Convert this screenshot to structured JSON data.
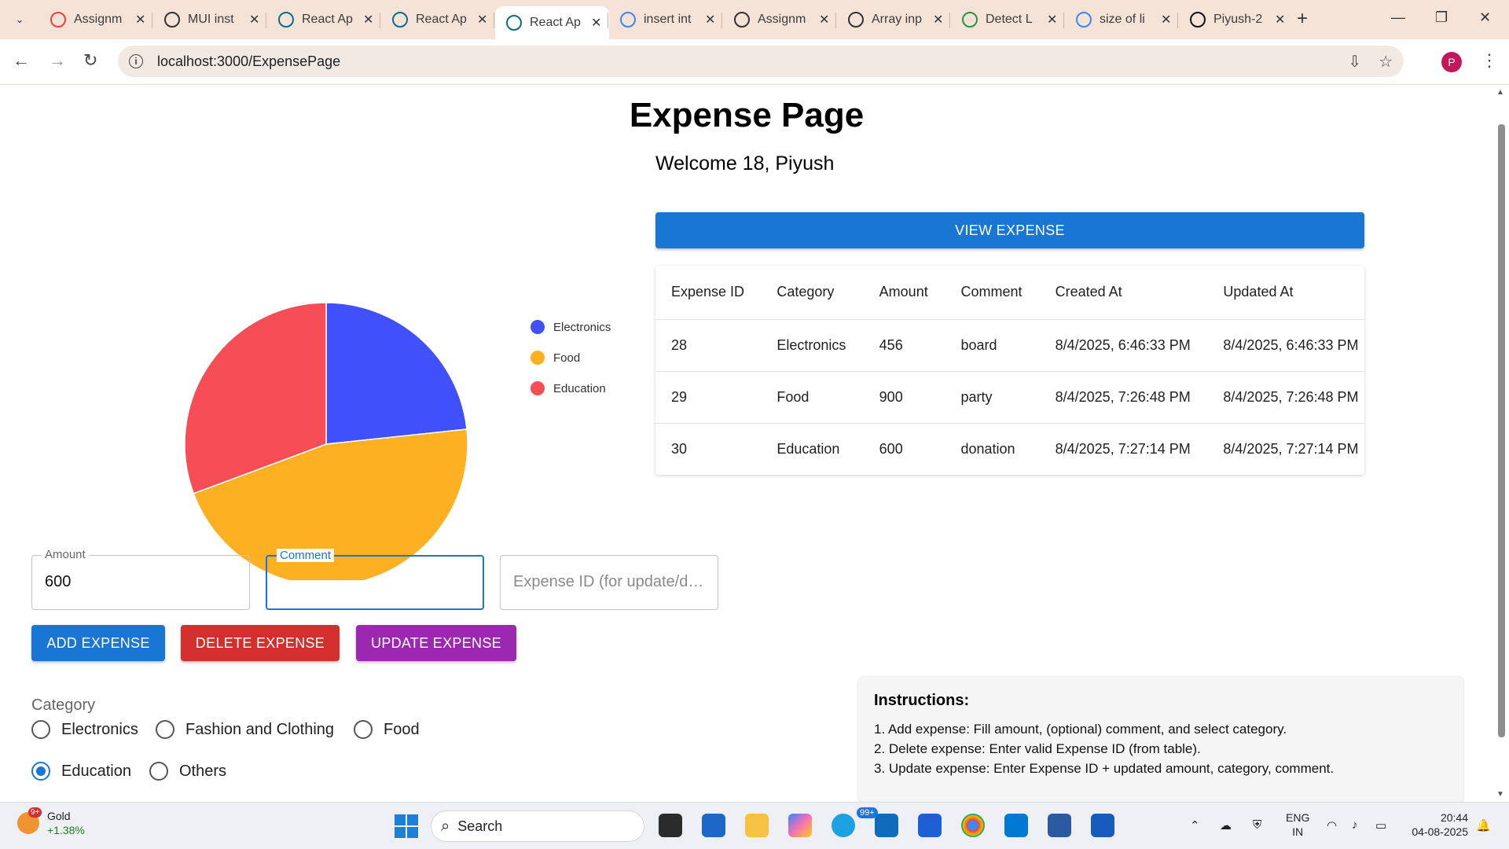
{
  "browser": {
    "tabs": [
      {
        "label": "Assignm",
        "icon": "gmail-icon",
        "active": false
      },
      {
        "label": "MUI inst",
        "icon": "openai-icon",
        "active": false
      },
      {
        "label": "React Ap",
        "icon": "react-icon",
        "active": false
      },
      {
        "label": "React Ap",
        "icon": "react-icon",
        "active": false
      },
      {
        "label": "React Ap",
        "icon": "react-icon",
        "active": true
      },
      {
        "label": "insert int",
        "icon": "google-icon",
        "active": false
      },
      {
        "label": "Assignm",
        "icon": "openai-icon",
        "active": false
      },
      {
        "label": "Array inp",
        "icon": "openai-icon",
        "active": false
      },
      {
        "label": "Detect L",
        "icon": "gfg-icon",
        "active": false
      },
      {
        "label": "size of li",
        "icon": "google-icon",
        "active": false
      },
      {
        "label": "Piyush-2",
        "icon": "github-icon",
        "active": false
      }
    ],
    "url": "localhost:3000/ExpensePage",
    "profile_initial": "P"
  },
  "page": {
    "title": "Expense Page",
    "welcome": "Welcome 18, Piyush",
    "view_button": "VIEW EXPENSE",
    "table": {
      "headers": [
        "Expense ID",
        "Category",
        "Amount",
        "Comment",
        "Created At",
        "Updated At"
      ],
      "rows": [
        [
          "28",
          "Electronics",
          "456",
          "board",
          "8/4/2025, 6:46:33 PM",
          "8/4/2025, 6:46:33 PM"
        ],
        [
          "29",
          "Food",
          "900",
          "party",
          "8/4/2025, 7:26:48 PM",
          "8/4/2025, 7:26:48 PM"
        ],
        [
          "30",
          "Education",
          "600",
          "donation",
          "8/4/2025, 7:27:14 PM",
          "8/4/2025, 7:27:14 PM"
        ]
      ]
    },
    "form": {
      "amount_label": "Amount",
      "amount_value": "600",
      "comment_label": "Comment",
      "comment_value": "",
      "expense_id_placeholder": "Expense ID (for update/delete)",
      "add_button": "ADD EXPENSE",
      "delete_button": "DELETE EXPENSE",
      "update_button": "UPDATE EXPENSE",
      "category_label": "Category",
      "categories": [
        "Electronics",
        "Fashion and Clothing",
        "Food",
        "Education",
        "Others"
      ],
      "selected_category": "Education"
    },
    "instructions": {
      "heading": "Instructions:",
      "items": [
        "1. Add expense: Fill amount, (optional) comment, and select category.",
        "2. Delete expense: Enter valid Expense ID (from table).",
        "3. Update expense: Enter Expense ID + updated amount, category, comment."
      ]
    }
  },
  "chart_data": {
    "type": "pie",
    "categories": [
      "Electronics",
      "Food",
      "Education"
    ],
    "values": [
      456,
      900,
      600
    ],
    "colors": [
      "#4050fb",
      "#fdb022",
      "#f64d57"
    ],
    "legend": "right"
  },
  "colors": {
    "primary": "#1976d2",
    "delete": "#d32f2f",
    "update": "#9c27b0"
  },
  "taskbar": {
    "weather_name": "Gold",
    "weather_change": "+1.38%",
    "weather_badge": "9+",
    "search_placeholder": "Search",
    "mail_badge": "99+",
    "lang_line1": "ENG",
    "lang_line2": "IN",
    "time": "20:44",
    "date": "04-08-2025"
  }
}
